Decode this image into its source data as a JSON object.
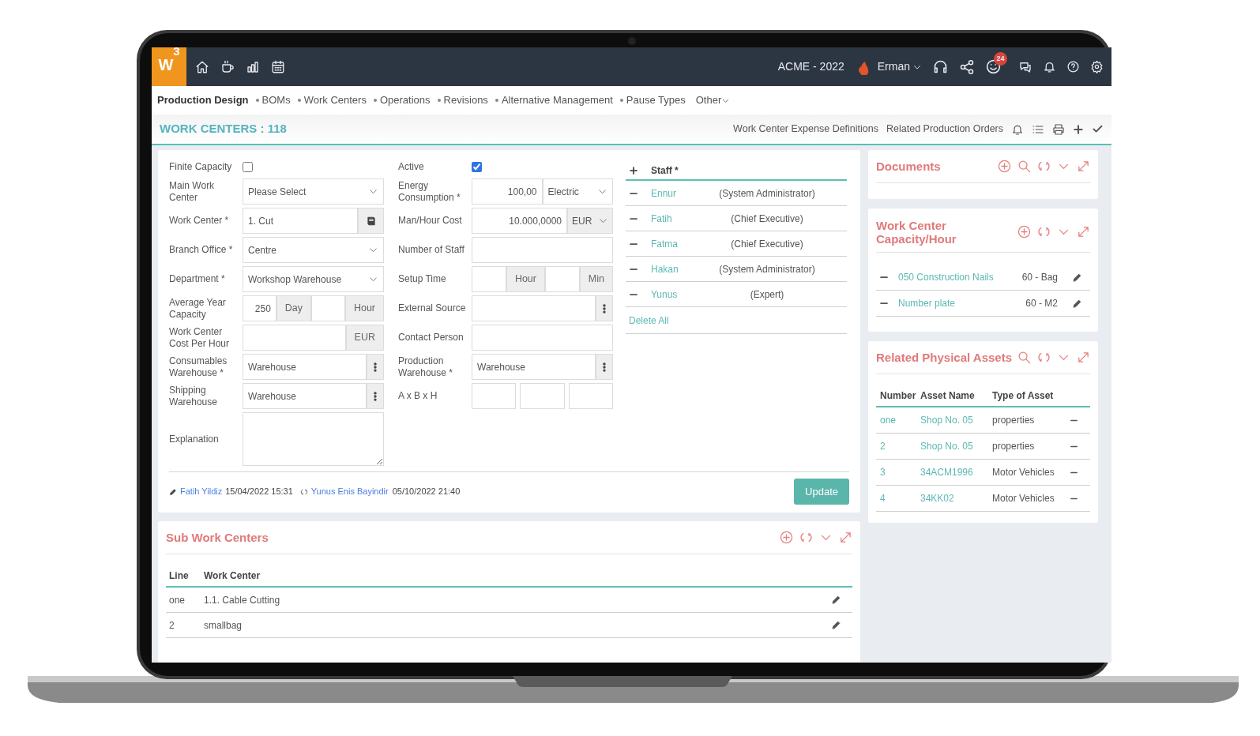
{
  "top_bar": {
    "logo": "W",
    "logo_sup": "3",
    "company": "ACME - 2022",
    "user": "Erman",
    "notification_count": "24"
  },
  "nav": {
    "section": "Production Design",
    "items": [
      "BOMs",
      "Work Centers",
      "Operations",
      "Revisions",
      "Alternative Management",
      "Pause Types"
    ],
    "more": "Other"
  },
  "page": {
    "title": "WORK CENTERS : 118",
    "links": [
      "Work Center Expense Definitions",
      "Related Production Orders"
    ]
  },
  "form": {
    "columns": [
      [
        {
          "label": "Finite Capacity",
          "kind": "checkbox",
          "checked": false
        },
        {
          "label": "Main Work Center",
          "kind": "group",
          "parts": [
            {
              "kind": "select",
              "value": "Please Select"
            }
          ]
        },
        {
          "label": "Work Center *",
          "kind": "group",
          "parts": [
            {
              "kind": "text",
              "value": "1. Cut"
            },
            {
              "kind": "book"
            }
          ]
        },
        {
          "label": "Branch Office *",
          "kind": "group",
          "parts": [
            {
              "kind": "select",
              "value": "Centre"
            }
          ]
        },
        {
          "label": "Department *",
          "kind": "group",
          "parts": [
            {
              "kind": "select",
              "value": "Workshop Warehouse"
            }
          ]
        },
        {
          "label": "Average Year Capacity",
          "kind": "group",
          "parts": [
            {
              "kind": "number",
              "value": "250"
            },
            {
              "kind": "addon",
              "value": "Day"
            },
            {
              "kind": "number"
            },
            {
              "kind": "addon",
              "value": "Hour"
            }
          ]
        },
        {
          "label": "Work Center Cost Per Hour",
          "kind": "group",
          "parts": [
            {
              "kind": "number"
            },
            {
              "kind": "addon",
              "value": "EUR"
            }
          ]
        },
        {
          "label": "Consumables Warehouse *",
          "kind": "group",
          "parts": [
            {
              "kind": "text",
              "value": "Warehouse"
            },
            {
              "kind": "dots"
            }
          ]
        },
        {
          "label": "Shipping Warehouse",
          "kind": "group",
          "parts": [
            {
              "kind": "text",
              "value": "Warehouse"
            },
            {
              "kind": "dots"
            }
          ]
        },
        {
          "label": "Explanation",
          "kind": "textarea"
        }
      ],
      [
        {
          "label": "Active",
          "kind": "checkbox",
          "checked": true
        },
        {
          "label": "Energy Consumption *",
          "kind": "group",
          "parts": [
            {
              "kind": "number",
              "value": "100,00"
            },
            {
              "kind": "select",
              "value": "Electric"
            }
          ]
        },
        {
          "label": "Man/Hour Cost",
          "kind": "group",
          "parts": [
            {
              "kind": "number",
              "value": "10.000,0000"
            },
            {
              "kind": "currency",
              "value": "EUR"
            }
          ]
        },
        {
          "label": "Number of Staff",
          "kind": "group",
          "parts": [
            {
              "kind": "number"
            }
          ]
        },
        {
          "label": "Setup Time",
          "kind": "group",
          "parts": [
            {
              "kind": "number"
            },
            {
              "kind": "addon",
              "value": "Hour"
            },
            {
              "kind": "number"
            },
            {
              "kind": "addon",
              "value": "Min"
            }
          ]
        },
        {
          "label": "External Source",
          "kind": "group",
          "parts": [
            {
              "kind": "text"
            },
            {
              "kind": "dots"
            }
          ]
        },
        {
          "label": "Contact Person",
          "kind": "group",
          "parts": [
            {
              "kind": "text"
            }
          ]
        },
        {
          "label": "Production Warehouse *",
          "kind": "group",
          "parts": [
            {
              "kind": "text",
              "value": "Warehouse"
            },
            {
              "kind": "dots"
            }
          ]
        },
        {
          "label": "A x B x H",
          "kind": "group",
          "parts": [
            {
              "kind": "box"
            },
            {
              "kind": "box"
            },
            {
              "kind": "box"
            }
          ]
        }
      ]
    ],
    "staff": {
      "heading": "Staff *",
      "members": [
        {
          "name": "Ennur",
          "role": "(System Administrator)"
        },
        {
          "name": "Fatih",
          "role": "(Chief Executive)"
        },
        {
          "name": "Fatma",
          "role": "(Chief Executive)"
        },
        {
          "name": "Hakan",
          "role": "(System Administrator)"
        },
        {
          "name": "Yunus",
          "role": "(Expert)"
        }
      ],
      "delete_all": "Delete All"
    },
    "created_by": "Fatih Yildiz",
    "created_at": "15/04/2022 15:31",
    "updated_by": "Yunus Enis Bayindir",
    "updated_at": "05/10/2022 21:40",
    "submit": "Update"
  },
  "sub_work_centers": {
    "title": "Sub Work Centers",
    "columns": [
      "Line",
      "Work Center"
    ],
    "rows": [
      {
        "line": "one",
        "work_center": "1.1. Cable Cutting"
      },
      {
        "line": "2",
        "work_center": "smallbag"
      }
    ]
  },
  "documents": {
    "title": "Documents"
  },
  "capacity": {
    "title": "Work Center Capacity/Hour",
    "items": [
      {
        "name": "050 Construction Nails",
        "amount": "60 - Bag"
      },
      {
        "name": "Number plate",
        "amount": "60 - M2"
      }
    ]
  },
  "assets": {
    "title": "Related Physical Assets",
    "columns": [
      "Number",
      "Asset Name",
      "Type of Asset"
    ],
    "rows": [
      {
        "number": "one",
        "name": "Shop No. 05",
        "type": "properties"
      },
      {
        "number": "2",
        "name": "Shop No. 05",
        "type": "properties"
      },
      {
        "number": "3",
        "name": "34ACM1996",
        "type": "Motor Vehicles"
      },
      {
        "number": "4",
        "name": "34KK02",
        "type": "Motor Vehicles"
      }
    ]
  }
}
